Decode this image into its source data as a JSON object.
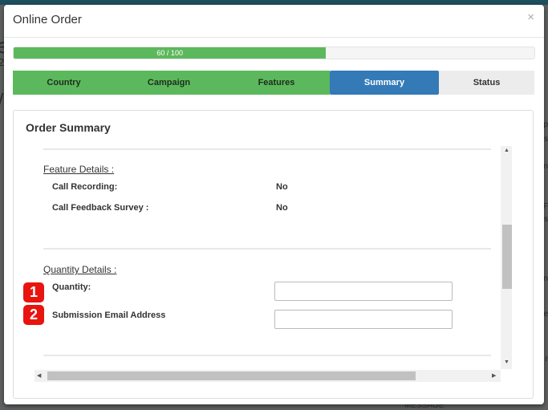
{
  "modal": {
    "title": "Online Order",
    "close_glyph": "×"
  },
  "progress": {
    "label": "60 / 100",
    "value": 60,
    "max": 100
  },
  "steps": [
    {
      "label": "Country",
      "state": "done"
    },
    {
      "label": "Campaign",
      "state": "done"
    },
    {
      "label": "Features",
      "state": "done"
    },
    {
      "label": "Summary",
      "state": "active"
    },
    {
      "label": "Status",
      "state": "todo"
    }
  ],
  "summary": {
    "title": "Order Summary",
    "feature_details": {
      "heading": "Feature Details :",
      "rows": [
        {
          "label": "Call Recording:",
          "value": "No"
        },
        {
          "label": "Call Feedback Survey :",
          "value": "No"
        }
      ]
    },
    "quantity_details": {
      "heading": "Quantity Details :",
      "quantity_label": "Quantity:",
      "quantity_value": "",
      "email_label": "Submission Email Address",
      "email_value": ""
    }
  },
  "badges": [
    "1",
    "2"
  ],
  "colors": {
    "step_done": "#5cb85c",
    "step_active": "#337ab7",
    "badge": "#e8140f"
  },
  "background": {
    "fragment_big": "e",
    "fragment_small": "2",
    "fragment_slash": "/",
    "right_fragments": [
      "p",
      "s",
      "n",
      "F",
      "s",
      "n",
      "e",
      "r"
    ],
    "bottom_fragment": "MESSAGE"
  }
}
